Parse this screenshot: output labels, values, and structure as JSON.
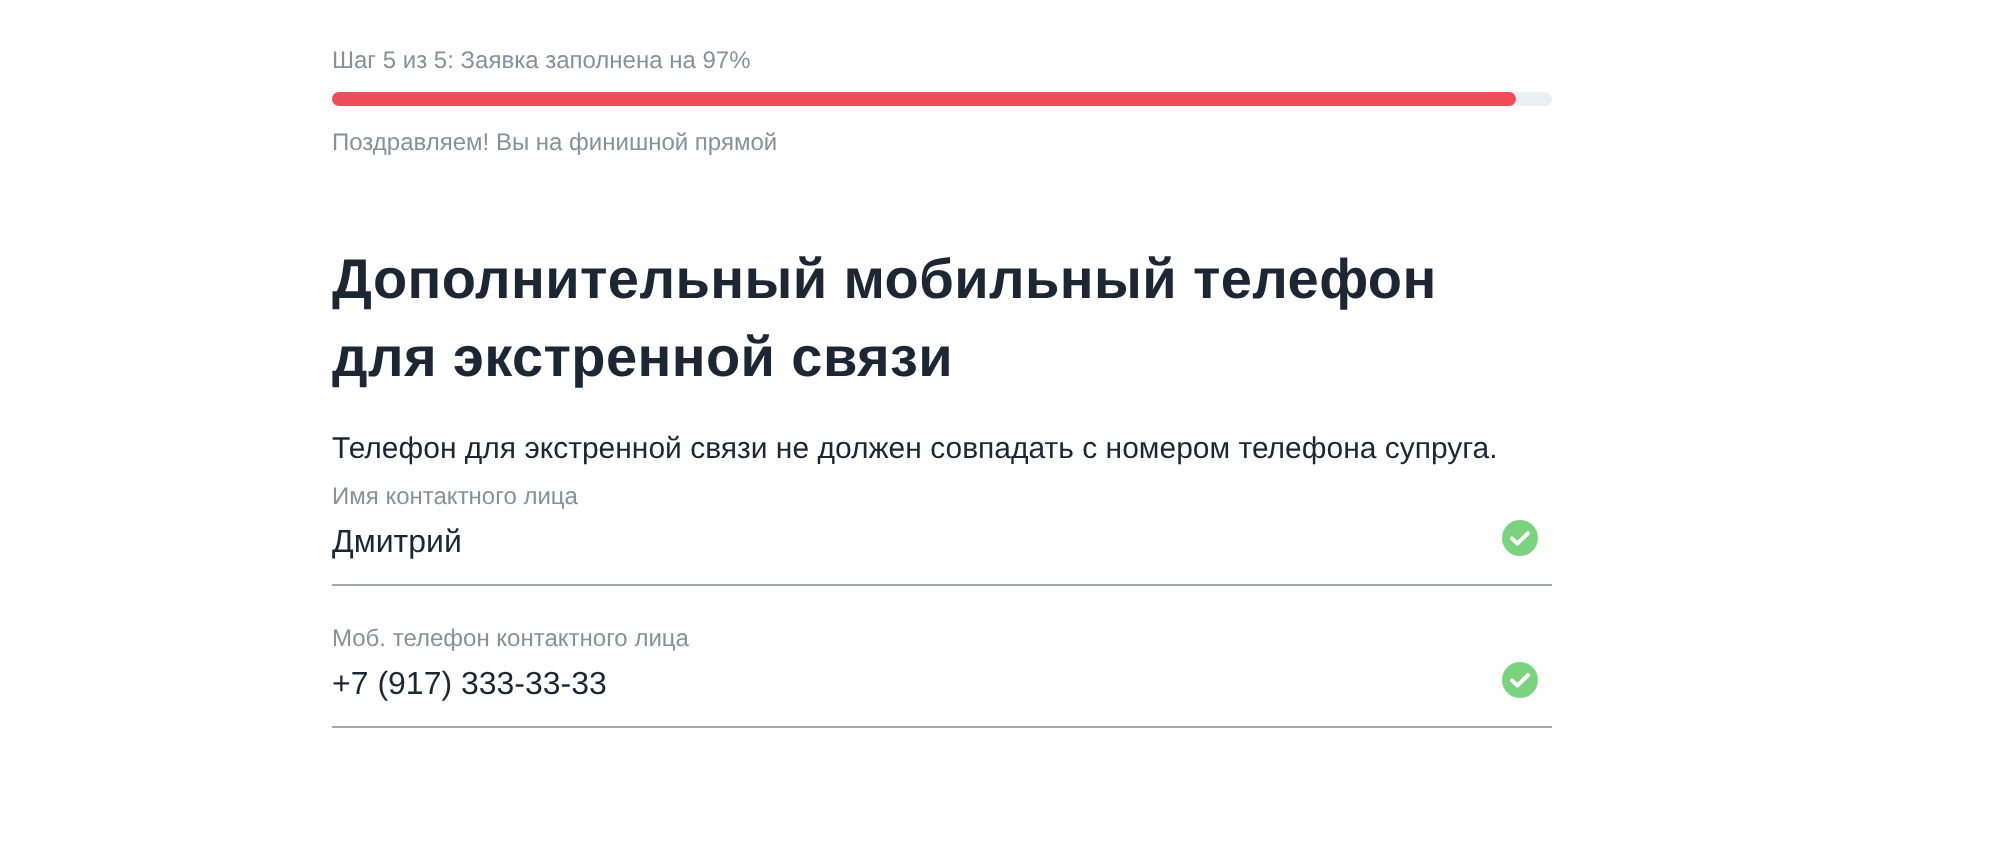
{
  "progress": {
    "step_text": "Шаг 5 из 5: Заявка заполнена на 97%",
    "level": 0.97,
    "message": "Поздравляем! Вы на финишной прямой"
  },
  "title": "Дополнительный мобильный телефон для экстренной связи",
  "description": "Телефон для экстренной связи не должен совпадать с номером телефона супруга.",
  "fields": [
    {
      "label": "Имя контактного лица",
      "value": "Дмитрий",
      "valid": true
    },
    {
      "label": "Моб. телефон контактного лица",
      "value": "+7 (917) 333-33-33",
      "valid": true
    }
  ]
}
